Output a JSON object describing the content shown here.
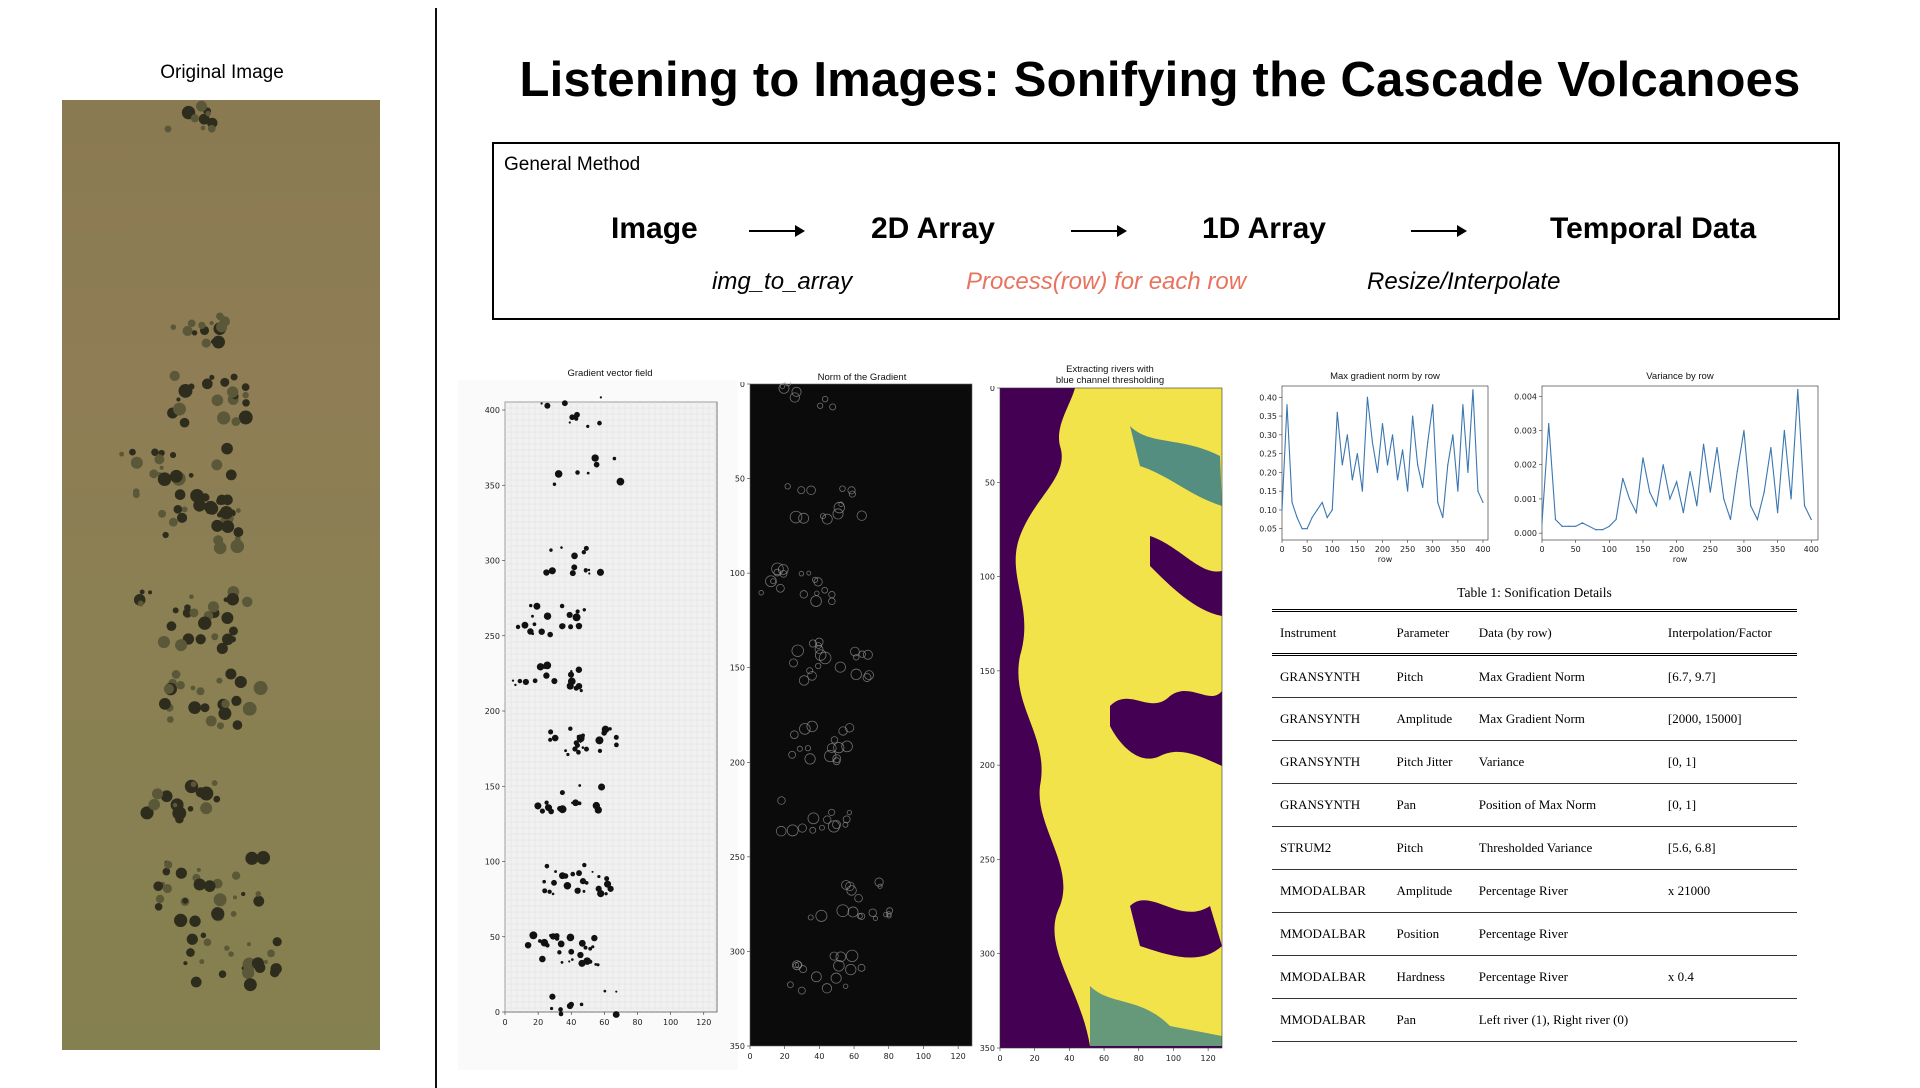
{
  "left_panel": {
    "label": "Original Image"
  },
  "title": "Listening to Images: Sonifying the Cascade Volcanoes",
  "method": {
    "label": "General Method",
    "steps": [
      "Image",
      "2D Array",
      "1D Array",
      "Temporal Data"
    ],
    "functions": [
      "img_to_array",
      "Process(row) for each row",
      "Resize/Interpolate"
    ]
  },
  "colors": {
    "highlight": "#e8735e",
    "plot_line": "#3a76b0",
    "viridis_dark": "#440154",
    "viridis_yellow": "#f3e34a"
  },
  "plots": {
    "gradient_field": {
      "title": "Gradient vector field",
      "yticks": [
        "400",
        "350",
        "300",
        "250",
        "200",
        "150",
        "100",
        "50",
        "0"
      ],
      "xticks": [
        "0",
        "20",
        "40",
        "60",
        "80",
        "100",
        "120"
      ]
    },
    "gradient_norm": {
      "title": "Norm of the Gradient",
      "yticks": [
        "0",
        "50",
        "100",
        "150",
        "200",
        "250",
        "300",
        "350"
      ],
      "xticks": [
        "0",
        "20",
        "40",
        "60",
        "80",
        "100",
        "120"
      ]
    },
    "rivers": {
      "title_line1": "Extracting rivers with",
      "title_line2": "blue channel thresholding",
      "yticks": [
        "0",
        "50",
        "100",
        "150",
        "200",
        "250",
        "300",
        "350"
      ],
      "xticks": [
        "0",
        "20",
        "40",
        "60",
        "80",
        "100",
        "120"
      ]
    }
  },
  "chart_data": [
    {
      "type": "line",
      "title": "Max gradient norm by row",
      "xlabel": "row",
      "ylabel": "",
      "xlim": [
        0,
        410
      ],
      "ylim": [
        0.02,
        0.43
      ],
      "xticks": [
        "0",
        "50",
        "100",
        "150",
        "200",
        "250",
        "300",
        "350",
        "400"
      ],
      "yticks": [
        "0.05",
        "0.10",
        "0.15",
        "0.20",
        "0.25",
        "0.30",
        "0.35",
        "0.40"
      ],
      "x": [
        0,
        10,
        20,
        30,
        40,
        50,
        60,
        70,
        80,
        90,
        100,
        110,
        120,
        130,
        140,
        150,
        160,
        170,
        180,
        190,
        200,
        210,
        220,
        230,
        240,
        250,
        260,
        270,
        280,
        290,
        300,
        310,
        320,
        330,
        340,
        350,
        360,
        370,
        380,
        390,
        400
      ],
      "values": [
        0.1,
        0.38,
        0.12,
        0.08,
        0.05,
        0.05,
        0.08,
        0.1,
        0.12,
        0.08,
        0.1,
        0.36,
        0.22,
        0.3,
        0.18,
        0.25,
        0.15,
        0.4,
        0.28,
        0.2,
        0.33,
        0.22,
        0.3,
        0.18,
        0.26,
        0.15,
        0.35,
        0.22,
        0.16,
        0.28,
        0.38,
        0.12,
        0.08,
        0.22,
        0.3,
        0.15,
        0.38,
        0.2,
        0.42,
        0.15,
        0.12
      ]
    },
    {
      "type": "line",
      "title": "Variance by row",
      "xlabel": "row",
      "ylabel": "",
      "xlim": [
        0,
        410
      ],
      "ylim": [
        -0.0002,
        0.0043
      ],
      "xticks": [
        "0",
        "50",
        "100",
        "150",
        "200",
        "250",
        "300",
        "350",
        "400"
      ],
      "yticks": [
        "0.000",
        "0.001",
        "0.002",
        "0.003",
        "0.004"
      ],
      "x": [
        0,
        10,
        20,
        30,
        40,
        50,
        60,
        70,
        80,
        90,
        100,
        110,
        120,
        130,
        140,
        150,
        160,
        170,
        180,
        190,
        200,
        210,
        220,
        230,
        240,
        250,
        260,
        270,
        280,
        290,
        300,
        310,
        320,
        330,
        340,
        350,
        360,
        370,
        380,
        390,
        400
      ],
      "values": [
        0.0003,
        0.0032,
        0.0004,
        0.0002,
        0.0002,
        0.0002,
        0.0003,
        0.0002,
        0.0001,
        0.0001,
        0.0002,
        0.0004,
        0.0016,
        0.001,
        0.0006,
        0.0022,
        0.0012,
        0.0008,
        0.002,
        0.001,
        0.0015,
        0.0006,
        0.0018,
        0.0008,
        0.0026,
        0.0012,
        0.0025,
        0.001,
        0.0004,
        0.0018,
        0.003,
        0.0008,
        0.0004,
        0.0012,
        0.0025,
        0.0006,
        0.003,
        0.001,
        0.0042,
        0.0008,
        0.0004
      ]
    }
  ],
  "table": {
    "caption": "Table 1: Sonification Details",
    "headers": [
      "Instrument",
      "Parameter",
      "Data (by row)",
      "Interpolation/Factor"
    ],
    "rows": [
      [
        "GRANSYNTH",
        "Pitch",
        "Max Gradient Norm",
        "[6.7, 9.7]"
      ],
      [
        "GRANSYNTH",
        "Amplitude",
        "Max Gradient Norm",
        "[2000, 15000]"
      ],
      [
        "GRANSYNTH",
        "Pitch Jitter",
        "Variance",
        "[0, 1]"
      ],
      [
        "GRANSYNTH",
        "Pan",
        "Position of Max Norm",
        "[0, 1]"
      ],
      [
        "STRUM2",
        "Pitch",
        "Thresholded Variance",
        "[5.6, 6.8]"
      ],
      [
        "MMODALBAR",
        "Amplitude",
        "Percentage River",
        "x 21000"
      ],
      [
        "MMODALBAR",
        "Position",
        "Percentage River",
        ""
      ],
      [
        "MMODALBAR",
        "Hardness",
        "Percentage River",
        "x 0.4"
      ],
      [
        "MMODALBAR",
        "Pan",
        "Left river (1), Right river (0)",
        ""
      ]
    ]
  }
}
